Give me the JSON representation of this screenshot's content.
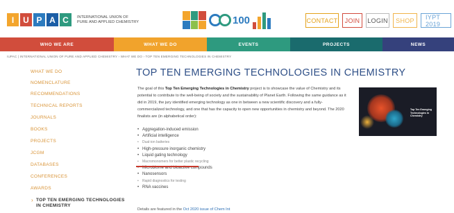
{
  "header": {
    "logo_letters": [
      "I",
      "U",
      "P",
      "A",
      "C"
    ],
    "logo_colors": [
      "#f3a52d",
      "#d14d3c",
      "#2c7bbf",
      "#1b5ea6",
      "#2e9a7f"
    ],
    "logo_line1": "INTERNATIONAL UNION OF",
    "logo_line2": "PURE AND APPLIED CHEMISTRY",
    "badge_100": "100",
    "top_buttons": {
      "contact": "CONTACT",
      "join": "JOIN",
      "login": "LOGIN",
      "shop": "SHOP",
      "iypt": "IYPT 2019"
    }
  },
  "nav": {
    "who": "WHO WE ARE",
    "what": "WHAT WE DO",
    "events": "EVENTS",
    "projects": "PROJECTS",
    "news": "NEWS"
  },
  "breadcrumb": "IUPAC | INTERNATIONAL UNION OF PURE AND APPLIED CHEMISTRY  ›  WHAT WE DO  ›  TOP TEN EMERGING TECHNOLOGIES IN CHEMISTRY",
  "sidebar": {
    "items": [
      "WHAT WE DO",
      "NOMENCLATURE",
      "RECOMMENDATIONS",
      "TECHNICAL REPORTS",
      "JOURNALS",
      "BOOKS",
      "PROJECTS",
      "JCGM",
      "DATABASES",
      "CONFERENCES",
      "AWARDS"
    ],
    "active_line1": "TOP TEN EMERGING TECHNOLOGIES",
    "active_line2": "IN CHEMISTRY"
  },
  "content": {
    "title": "TOP TEN EMERGING TECHNOLOGIES IN CHEMISTRY",
    "intro_before": "The goal of this ",
    "intro_bold": "Top Ten Emerging Technologies in Chemistry",
    "intro_after": " project is to showcase the value of Chemistry and its potential to contribute to the well-being of society and the sustainability of Planet Earth. Following the same guidance as it did in 2019, the jury identified emerging technology as one in between a new scientific discovery and a fully-commercialized technology, and one that has the capacity to open new opportunities in chemistry and beyond. The 2020 finalists are (in alphabetical order):",
    "list": [
      "Aggregation-induced emission",
      "Artificial intelligence",
      "Dual-ion batteries",
      "High-pressure inorganic chemistry",
      "Liquid gating technology",
      "Macromonomers for better plastic recycling",
      "Microbiome and bioactive compounds",
      "Nanosensors",
      "Rapid diagnostics for testing",
      "RNA vaccines"
    ],
    "details_before": "Details are featured in the ",
    "details_link": "Oct 2020 issue of Chem Int"
  },
  "cover": {
    "line1": "Top Ten Emerging",
    "line2": "Technologies in",
    "line3": "Chemistry"
  }
}
